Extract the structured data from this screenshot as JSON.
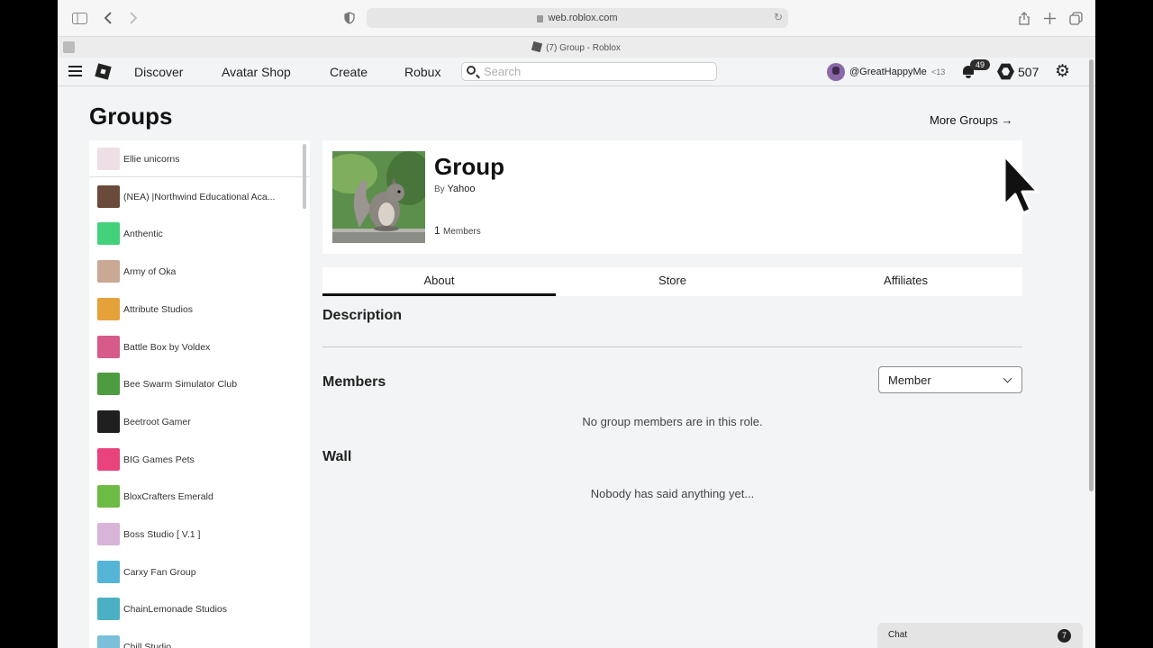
{
  "browser": {
    "url": "web.roblox.com",
    "tab_title": "(7) Group - Roblox"
  },
  "nav": {
    "links": [
      "Discover",
      "Avatar Shop",
      "Create",
      "Robux"
    ],
    "search_placeholder": "Search",
    "username": "@GreatHappyMe",
    "age_tag": "<13",
    "notification_count": "49",
    "robux_balance": "507"
  },
  "page": {
    "title": "Groups",
    "more_groups": "More Groups →"
  },
  "groups": [
    {
      "name": "Ellie unicorns",
      "color": "#eedfe6"
    },
    {
      "name": "(NEA) |Northwind Educational Aca...",
      "color": "#6a4a3a"
    },
    {
      "name": "Anthentic",
      "color": "#43d17b"
    },
    {
      "name": "Army of Oka",
      "color": "#c9a894"
    },
    {
      "name": "Attribute Studios",
      "color": "#e6a23a"
    },
    {
      "name": "Battle Box by Voldex",
      "color": "#d65a8a"
    },
    {
      "name": "Bee Swarm Simulator Club",
      "color": "#4d9c3f"
    },
    {
      "name": "Beetroot Gamer",
      "color": "#1f1f1f"
    },
    {
      "name": "BIG Games Pets",
      "color": "#e8437c"
    },
    {
      "name": "BloxCrafters Emerald",
      "color": "#6cbb45"
    },
    {
      "name": "Boss Studio [ V.1 ]",
      "color": "#d7b4d8"
    },
    {
      "name": "Carxy Fan Group",
      "color": "#55b5d6"
    },
    {
      "name": "ChainLemonade Studios",
      "color": "#4bb0c4"
    },
    {
      "name": "Chill Studio",
      "color": "#7bc0da"
    }
  ],
  "group": {
    "name": "Group",
    "by_label": "By",
    "owner": "Yahoo",
    "member_count": "1",
    "members_label": "Members"
  },
  "tabs": [
    "About",
    "Store",
    "Affiliates"
  ],
  "sections": {
    "description": "Description",
    "members": "Members",
    "role_selected": "Member",
    "members_empty": "No group members are in this role.",
    "wall": "Wall",
    "wall_empty": "Nobody has said anything yet..."
  },
  "chat": {
    "label": "Chat",
    "unread": "7"
  }
}
